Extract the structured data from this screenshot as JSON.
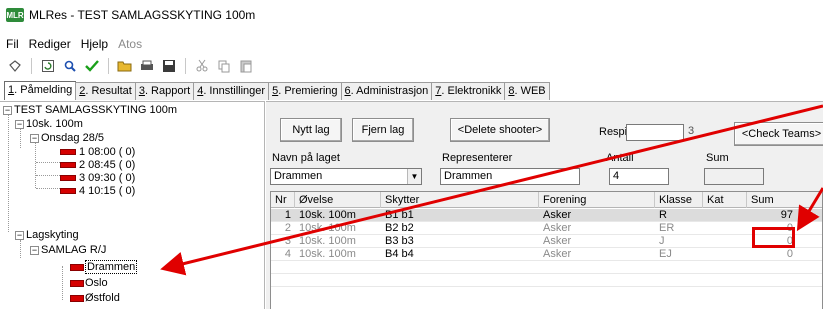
{
  "window": {
    "app_icon_text": "MLR",
    "title": "MLRes - TEST SAMLAGSSKYTING 100m"
  },
  "menu": [
    "Fil",
    "Rediger",
    "Hjelp",
    "Atos"
  ],
  "toolbar": {
    "icons": [
      "pin-icon",
      "refresh-icon",
      "search-icon",
      "check-icon",
      "open-folder-icon",
      "print-icon",
      "save-icon",
      "cut-icon",
      "copy-icon",
      "paste-icon"
    ],
    "check_color": "#1aa01a"
  },
  "tabs": [
    {
      "num": "1",
      "label": ". Påmelding"
    },
    {
      "num": "2",
      "label": ". Resultat"
    },
    {
      "num": "3",
      "label": ". Rapport"
    },
    {
      "num": "4",
      "label": ". Innstillinger"
    },
    {
      "num": "5",
      "label": ". Premiering"
    },
    {
      "num": "6",
      "label": ". Administrasjon"
    },
    {
      "num": "7",
      "label": ". Elektronikk"
    },
    {
      "num": "8",
      "label": ". WEB"
    }
  ],
  "tree": {
    "root": "TEST SAMLAGSSKYTING 100m",
    "event": "10sk. 100m",
    "day": "Onsdag 28/5",
    "relays": [
      "1 08:00  ( 0)",
      "2 08:45  ( 0)",
      "3 09:30  ( 0)",
      "4 10:15  ( 0)"
    ],
    "team_group": "Lagskyting",
    "team_class": "SAMLAG R/J",
    "teams": [
      "Drammen",
      "Oslo",
      "Østfold"
    ],
    "selected_team": "Drammen",
    "lane_color": "#d50000"
  },
  "form": {
    "new_team_button": "Nytt lag",
    "remove_team_button": "Fjern lag",
    "delete_shooter_button": "<Delete shooter>",
    "check_teams_button": "<Check Teams>",
    "respit_label": "Respit",
    "respit_value": "",
    "respit_hidden": "3",
    "team_name_label": "Navn på laget",
    "team_name_value": "Drammen",
    "represents_label": "Representerer",
    "represents_value": "Drammen",
    "count_label": "Antall",
    "count_value": "4",
    "sum_label": "Sum",
    "sum_value": ""
  },
  "grid": {
    "headers": [
      "Nr",
      "Øvelse",
      "Skytter",
      "Forening",
      "Klasse",
      "Kat",
      "Sum"
    ],
    "rows": [
      {
        "nr": "1",
        "ovelse": "10sk. 100m",
        "skytter": "B1 b1",
        "forening": "Asker",
        "klasse": "R",
        "kat": "",
        "sum": "97"
      },
      {
        "nr": "2",
        "ovelse": "10sk. 100m",
        "skytter": "B2 b2",
        "forening": "Asker",
        "klasse": "ER",
        "kat": "",
        "sum": "0"
      },
      {
        "nr": "3",
        "ovelse": "10sk. 100m",
        "skytter": "B3 b3",
        "forening": "Asker",
        "klasse": "J",
        "kat": "",
        "sum": "0"
      },
      {
        "nr": "4",
        "ovelse": "10sk. 100m",
        "skytter": "B4 b4",
        "forening": "Asker",
        "klasse": "EJ",
        "kat": "",
        "sum": "0"
      }
    ]
  },
  "annotations": {
    "color": "#e00000"
  }
}
